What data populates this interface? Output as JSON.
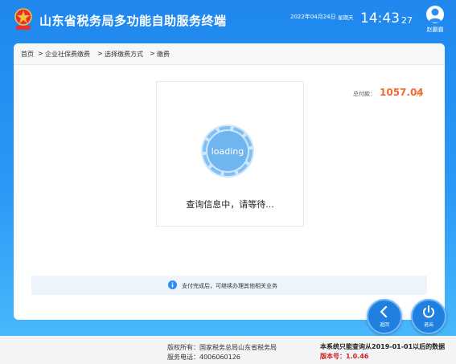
{
  "header": {
    "title": "山东省税务局多功能自助服务终端",
    "date": "2022年04月24日",
    "weekday": "星期天",
    "time": "14:43",
    "seconds": "27",
    "user_name": "赵霸霸"
  },
  "breadcrumb": [
    "首页",
    ">",
    "企业社保费缴费",
    ">",
    "选择缴费方式",
    ">",
    "缴费"
  ],
  "payment": {
    "total_label": "总付款：",
    "total_amount": "1057.04",
    "unit": "元"
  },
  "loading": {
    "spinner_text": "loading",
    "message": "查询信息中，请等待..."
  },
  "notice": {
    "text": "支付完成后，可继续办理其他相关业务"
  },
  "nav": {
    "back_label": "返回",
    "exit_label": "退出"
  },
  "footer": {
    "copyright": "版权所有：国家税务总局山东省税务局",
    "hotline": "服务电话：4006060126",
    "data_note": "本系统只能查询从2019-01-01以后的数据",
    "version": "版本号：1.0.46"
  },
  "colors": {
    "brand_blue": "#1f87ee",
    "amount_orange": "#f26a33",
    "version_red": "#d31c1c"
  },
  "icons": {
    "emblem": "tax-emblem-icon",
    "user": "user-icon",
    "spinner": "loading-spinner-icon",
    "info": "info-icon",
    "back": "chevron-left-icon",
    "exit": "power-icon"
  }
}
